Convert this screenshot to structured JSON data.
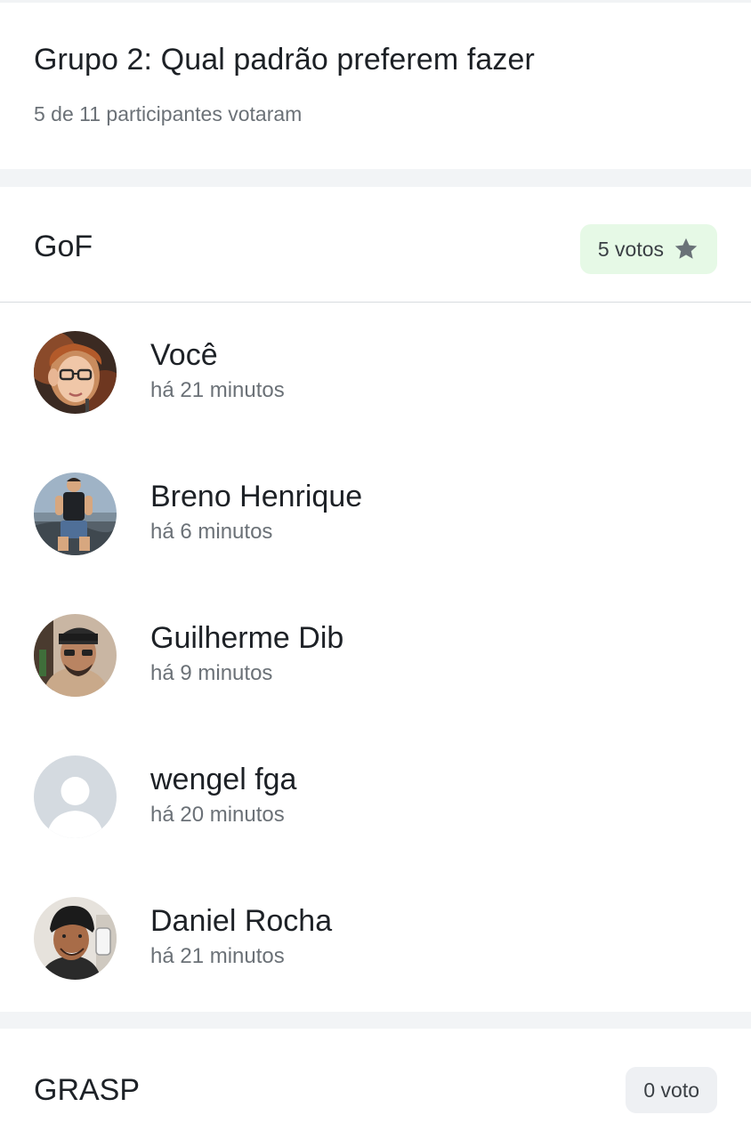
{
  "poll": {
    "title": "Grupo 2: Qual padrão preferem fazer",
    "subtitle": "5 de 11 participantes votaram"
  },
  "options": [
    {
      "name": "GoF",
      "votes_label": "5 votos",
      "winner": true,
      "badge_color": "#e6f9e6",
      "icon": "star-icon",
      "voters": [
        {
          "name": "Você",
          "time": "há 21 minutos",
          "avatar": "photo-avatar"
        },
        {
          "name": "Breno Henrique",
          "time": "há 6 minutos",
          "avatar": "photo-avatar"
        },
        {
          "name": "Guilherme Dib",
          "time": "há 9 minutos",
          "avatar": "photo-avatar"
        },
        {
          "name": "wengel fga",
          "time": "há 20 minutos",
          "avatar": "default-user-avatar"
        },
        {
          "name": "Daniel Rocha",
          "time": "há 21 minutos",
          "avatar": "photo-avatar"
        }
      ]
    },
    {
      "name": "GRASP",
      "votes_label": "0 voto",
      "winner": false,
      "badge_color": "#eef0f3"
    }
  ],
  "colors": {
    "accent_badge": "#e6f9e6",
    "muted_text": "#6b7177",
    "separator": "#f2f4f6"
  }
}
